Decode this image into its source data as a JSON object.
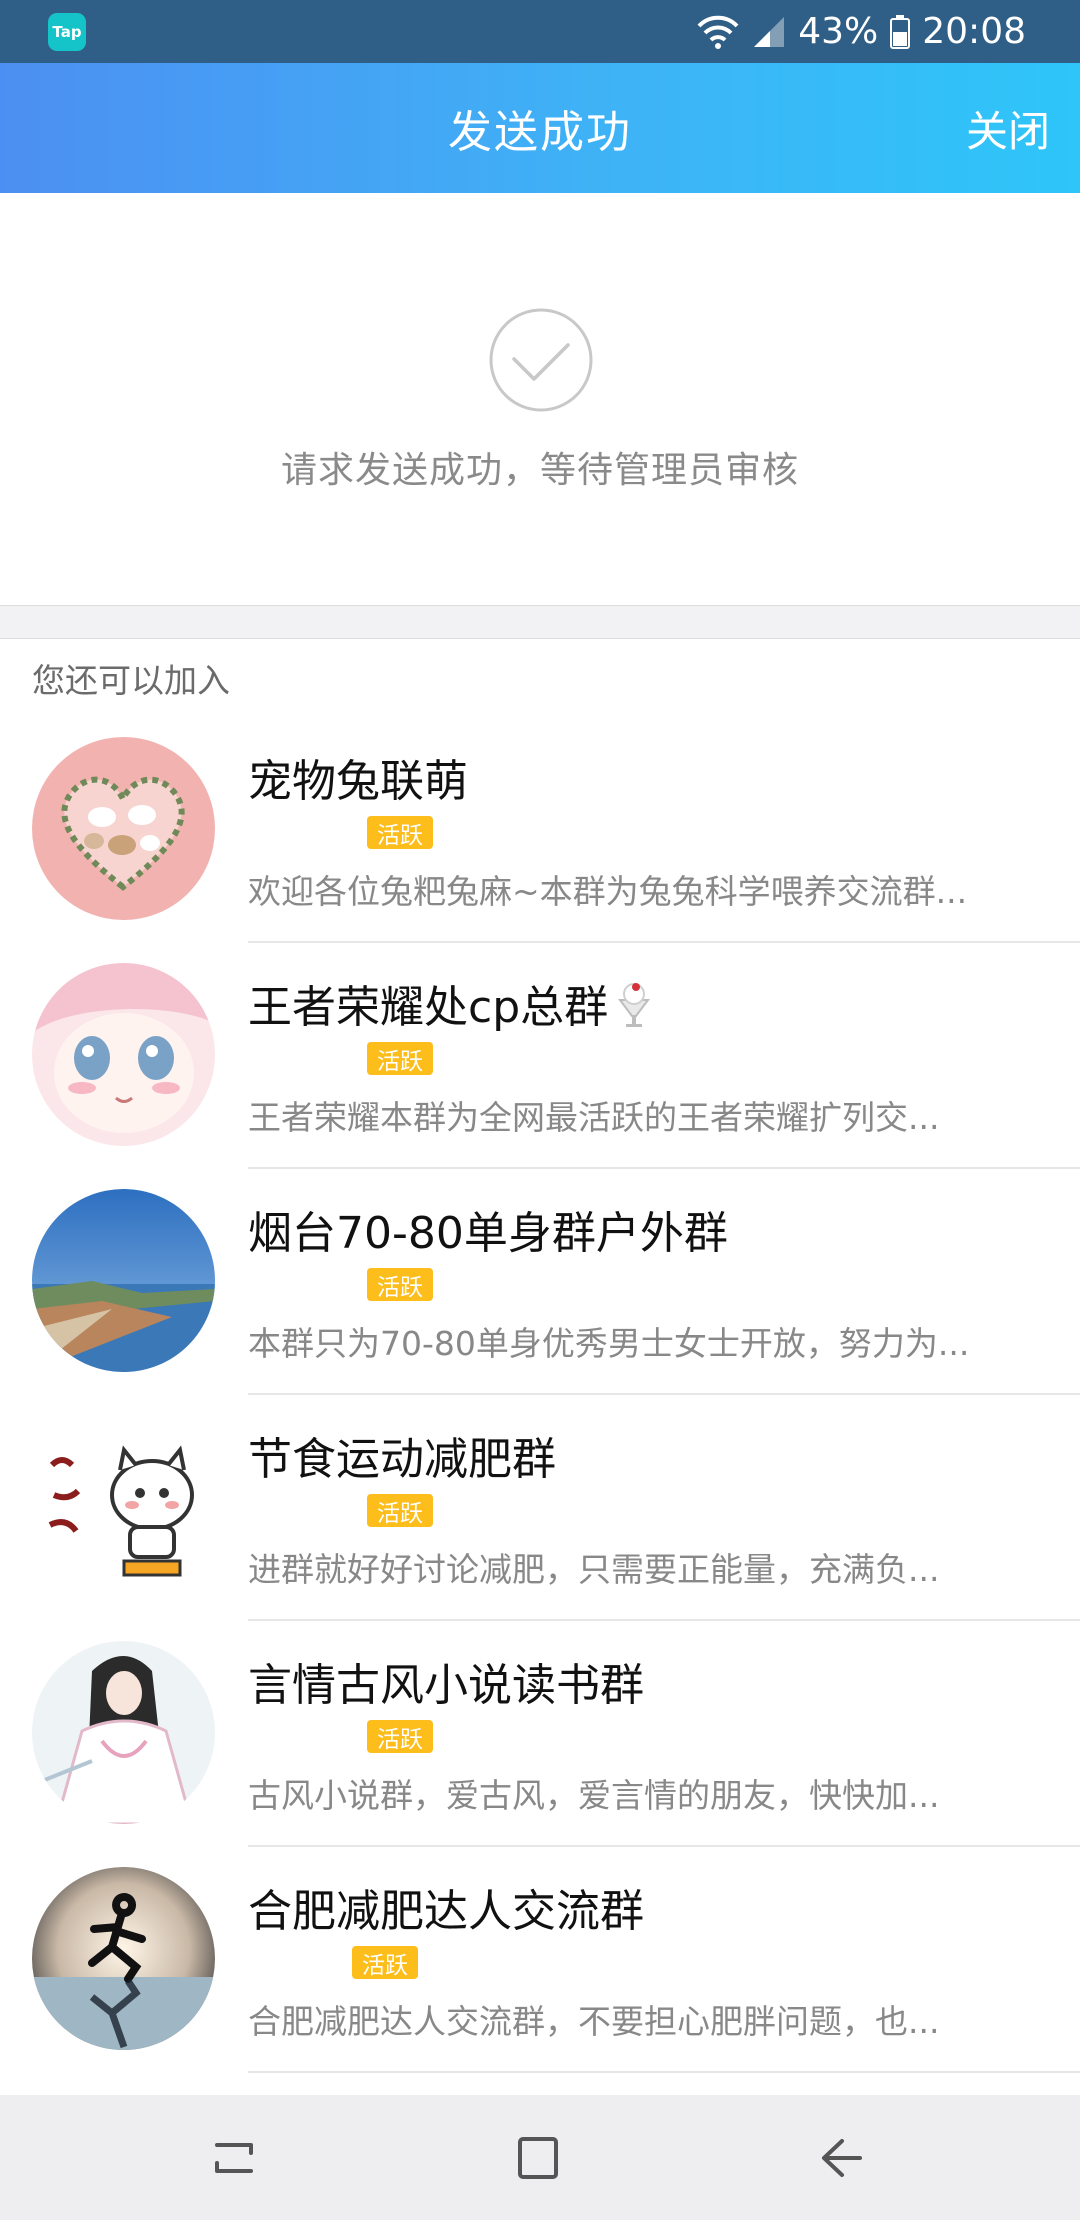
{
  "status_bar": {
    "app_badge": "Tap",
    "battery_percent": "43%",
    "time": "20:08",
    "icons": [
      "wifi-icon",
      "signal-icon",
      "battery-icon"
    ]
  },
  "header": {
    "title": "发送成功",
    "close_label": "关闭"
  },
  "success": {
    "icon": "check-circle-icon",
    "message": "请求发送成功，等待管理员审核"
  },
  "suggestions": {
    "title": "您还可以加入",
    "badge_color": "#fdbd1a",
    "groups": [
      {
        "name": "宠物兔联萌",
        "badge": "活跃",
        "description": "欢迎各位兔粑兔麻~本群为兔兔科学喂养交流群..."
      },
      {
        "name": "王者荣耀处cp总群",
        "name_icon": "ice-cream-emoji-icon",
        "badge": "活跃",
        "description": "王者荣耀本群为全网最活跃的王者荣耀扩列交..."
      },
      {
        "name": "烟台70-80单身群户外群",
        "badge": "活跃",
        "description": "本群只为70-80单身优秀男士女士开放，努力为..."
      },
      {
        "name": "节食运动减肥群",
        "badge": "活跃",
        "description": "进群就好好讨论减肥，只需要正能量，充满负..."
      },
      {
        "name": "言情古风小说读书群",
        "badge": "活跃",
        "description": "古风小说群，爱古风，爱言情的朋友，快快加..."
      },
      {
        "name": "合肥减肥达人交流群",
        "badge": "活跃",
        "description": "合肥减肥达人交流群，不要担心肥胖问题，也..."
      }
    ]
  },
  "nav_bar": {
    "buttons": [
      "recent-apps-icon",
      "home-icon",
      "back-icon"
    ]
  },
  "colors": {
    "header_gradient_start": "#4c8ff2",
    "header_gradient_end": "#2ec5f9",
    "status_bar": "#2f5f86"
  }
}
